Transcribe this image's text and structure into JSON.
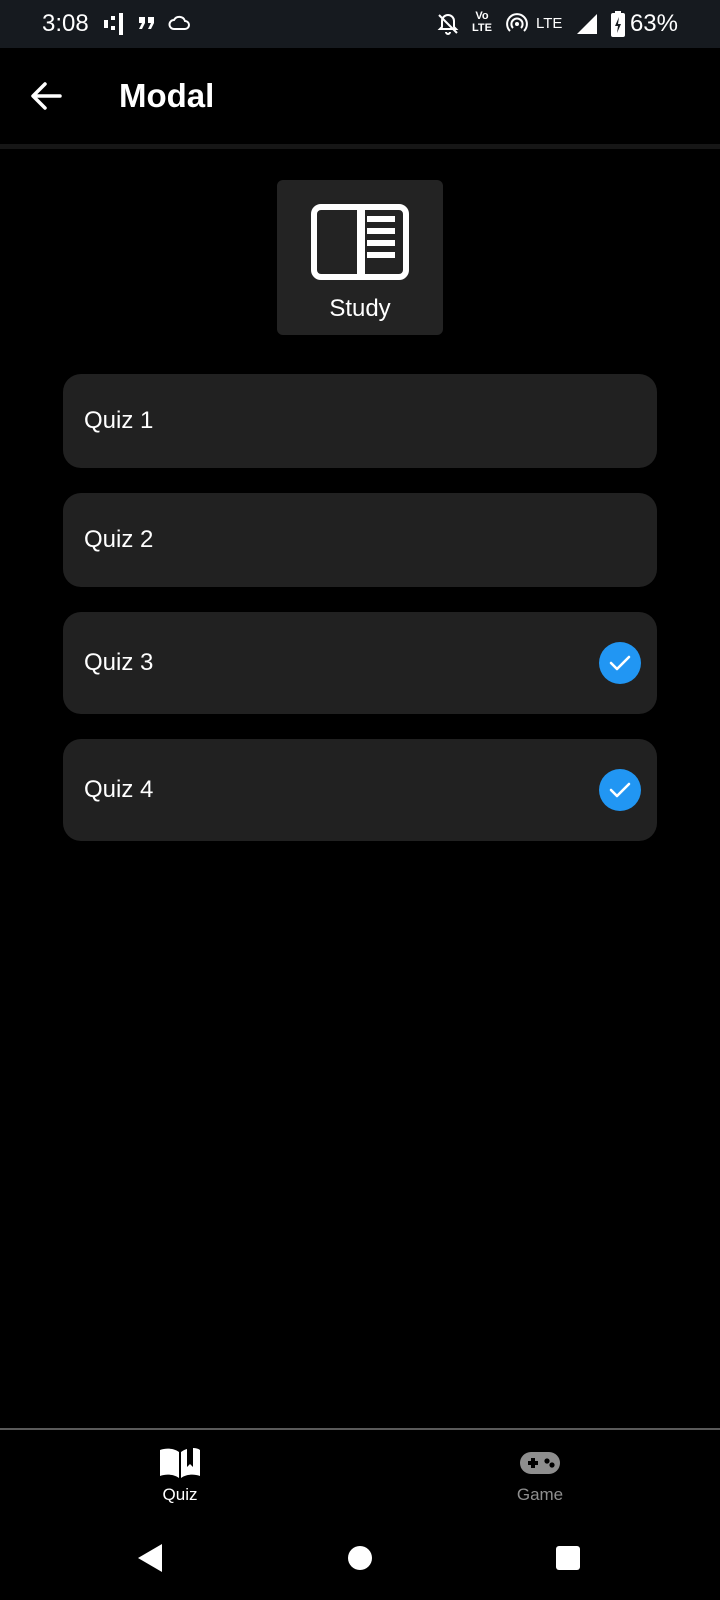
{
  "status_bar": {
    "time": "3:08",
    "network": "LTE",
    "volte_top": "Vo",
    "volte_bottom": "LTE",
    "battery": "63%"
  },
  "header": {
    "title": "Modal",
    "back_icon": "arrow-left-icon"
  },
  "study": {
    "label": "Study",
    "icon": "book-open-page-icon"
  },
  "quizzes": [
    {
      "label": "Quiz 1",
      "checked": false
    },
    {
      "label": "Quiz 2",
      "checked": false
    },
    {
      "label": "Quiz 3",
      "checked": true
    },
    {
      "label": "Quiz 4",
      "checked": true
    }
  ],
  "bottom_nav": {
    "tabs": [
      {
        "label": "Quiz",
        "icon": "open-book-icon",
        "active": true
      },
      {
        "label": "Game",
        "icon": "gamepad-icon",
        "active": false
      }
    ]
  },
  "colors": {
    "accent": "#2196f3",
    "card_bg": "#212121",
    "inactive_tab": "#8e8e8e"
  }
}
